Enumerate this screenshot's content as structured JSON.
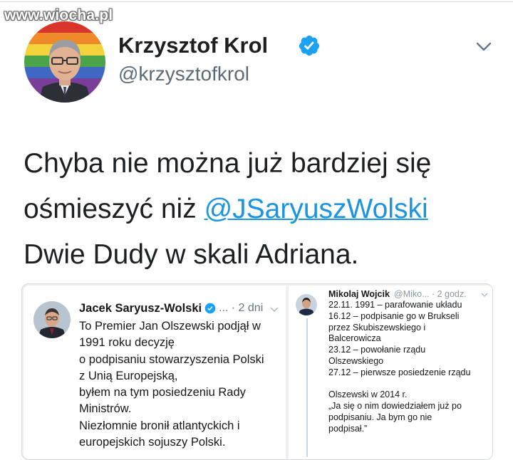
{
  "watermark": "www.wiocha.pl",
  "tweet": {
    "author_name": "Krzysztof Krol",
    "author_handle": "@krzysztofkrol",
    "text_line1": "Chyba nie można już bardziej się",
    "text_line2_prefix": "ośmieszyć niż ",
    "mention": "@JSaryuszWolski",
    "text_line3": "Dwie Dudy w skali Adriana."
  },
  "embedded_left": {
    "author_name": "Jacek Saryusz-Wolski",
    "meta": "... · 2 dni",
    "lines": [
      "To Premier Jan Olszewski podjął w",
      "1991 roku decyzję",
      "o podpisaniu stowarzyszenia Polski",
      "z Unią Europejską,",
      "byłem na tym posiedzeniu Rady",
      "Ministrów.",
      "Niezłomnie bronił atlantyckich i",
      "europejskich sojuszy Polski."
    ]
  },
  "embedded_right": {
    "author_name": "Mikolaj Wojcik",
    "meta": "@Miko... · 2 godz.",
    "lines_a": [
      "22.11. 1991 – parafowanie układu",
      "16.12 – podpisanie go w Brukseli",
      "przez Skubiszewskiego i",
      "Balcerowicza",
      "23.12 – powołanie rządu",
      "Olszewskiego",
      "27.12 – pierwsze posiedzenie rządu"
    ],
    "lines_b": [
      "Olszewski w 2014 r.",
      "„Ja się o nim dowiedziałem już po",
      "podpisaniu. Ja bym go nie",
      "podpisał.”"
    ]
  },
  "icons": {
    "verified": "verified-badge-icon",
    "menu": "chevron-down-icon"
  },
  "colors": {
    "link": "#1b95e0",
    "verified": "#1da1f2",
    "text": "#1c2022",
    "secondary": "#5b6b78"
  }
}
